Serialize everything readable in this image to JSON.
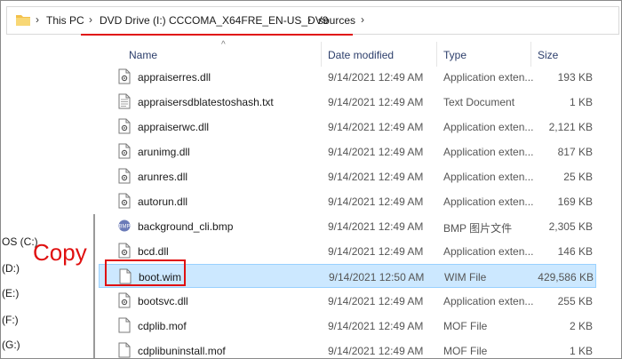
{
  "address": {
    "crumbs": [
      "This PC",
      "DVD Drive (I:) CCCOMA_X64FRE_EN-US_DV9",
      "sources"
    ]
  },
  "nav": {
    "drives": [
      "OS (C:)",
      "(D:)",
      "(E:)",
      "(F:)",
      "(G:)"
    ]
  },
  "annotation": {
    "copy_label": "Copy"
  },
  "columns": {
    "name": "Name",
    "date": "Date modified",
    "type": "Type",
    "size": "Size"
  },
  "files": [
    {
      "name": "appraiserres.dll",
      "date": "9/14/2021 12:49 AM",
      "type": "Application exten...",
      "size": "193 KB",
      "icon": "dll-icon"
    },
    {
      "name": "appraisersdblatestoshash.txt",
      "date": "9/14/2021 12:49 AM",
      "type": "Text Document",
      "size": "1 KB",
      "icon": "text-file-icon"
    },
    {
      "name": "appraiserwc.dll",
      "date": "9/14/2021 12:49 AM",
      "type": "Application exten...",
      "size": "2,121 KB",
      "icon": "dll-icon"
    },
    {
      "name": "arunimg.dll",
      "date": "9/14/2021 12:49 AM",
      "type": "Application exten...",
      "size": "817 KB",
      "icon": "dll-icon"
    },
    {
      "name": "arunres.dll",
      "date": "9/14/2021 12:49 AM",
      "type": "Application exten...",
      "size": "25 KB",
      "icon": "dll-icon"
    },
    {
      "name": "autorun.dll",
      "date": "9/14/2021 12:49 AM",
      "type": "Application exten...",
      "size": "169 KB",
      "icon": "dll-icon"
    },
    {
      "name": "background_cli.bmp",
      "date": "9/14/2021 12:49 AM",
      "type": "BMP 图片文件",
      "size": "2,305 KB",
      "icon": "image-file-icon"
    },
    {
      "name": "bcd.dll",
      "date": "9/14/2021 12:49 AM",
      "type": "Application exten...",
      "size": "146 KB",
      "icon": "dll-icon"
    },
    {
      "name": "boot.wim",
      "date": "9/14/2021 12:50 AM",
      "type": "WIM File",
      "size": "429,586 KB",
      "icon": "blank-file-icon",
      "selected": true
    },
    {
      "name": "bootsvc.dll",
      "date": "9/14/2021 12:49 AM",
      "type": "Application exten...",
      "size": "255 KB",
      "icon": "dll-icon"
    },
    {
      "name": "cdplib.mof",
      "date": "9/14/2021 12:49 AM",
      "type": "MOF File",
      "size": "2 KB",
      "icon": "blank-file-icon"
    },
    {
      "name": "cdplibuninstall.mof",
      "date": "9/14/2021 12:49 AM",
      "type": "MOF File",
      "size": "1 KB",
      "icon": "blank-file-icon"
    }
  ],
  "colors": {
    "accent_red": "#e01010",
    "selection": "#cce8ff"
  }
}
